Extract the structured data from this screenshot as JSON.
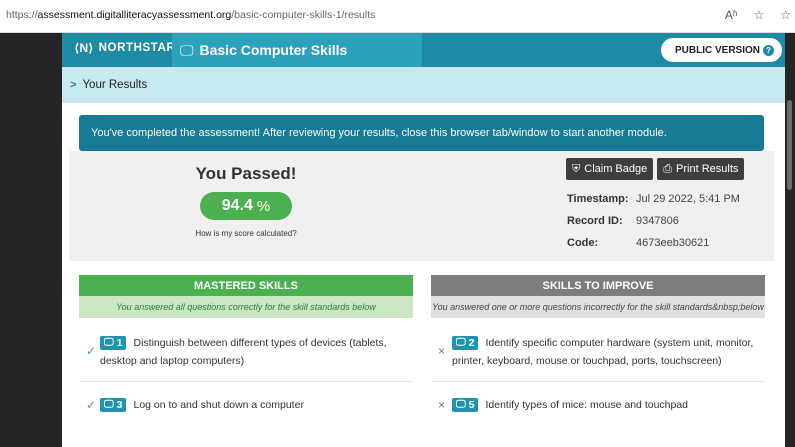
{
  "browser": {
    "url_prefix": "https://",
    "url_host": "assessment.digitalliteracyassessment.org",
    "url_path": "/basic-computer-skills-1/results",
    "icons": [
      "read-aloud-icon",
      "favorite-star-icon",
      "favorites-icon"
    ],
    "icon_glyphs": {
      "read": "Aʱ",
      "star": "☆",
      "fav": "☆"
    }
  },
  "header": {
    "logo_text": "NORTHSTAR",
    "module_title": "Basic Computer Skills",
    "public_version_label": "PUBLIC VERSION"
  },
  "breadcrumb": {
    "label": "Your Results"
  },
  "banner": {
    "text": "You've completed the assessment! After reviewing your results, close this browser tab/window to start another module."
  },
  "result": {
    "heading": "You Passed!",
    "score": "94.4",
    "score_unit": "%",
    "how_link": "How is my score calculated?",
    "claim_badge_label": "Claim Badge",
    "print_results_label": "Print Results",
    "meta": [
      {
        "key": "Timestamp:",
        "value": "Jul 29 2022, 5:41 PM"
      },
      {
        "key": "Record ID:",
        "value": "9347806"
      },
      {
        "key": "Code:",
        "value": "4673eeb30621"
      }
    ]
  },
  "mastered": {
    "title": "MASTERED SKILLS",
    "subtitle": "You answered all questions correctly for the skill standards below",
    "items": [
      {
        "num": "1",
        "text": "Distinguish between different types of devices (tablets, desktop and laptop computers)"
      },
      {
        "num": "3",
        "text": "Log on to and shut down a computer"
      }
    ]
  },
  "improve": {
    "title": "SKILLS TO IMPROVE",
    "subtitle": "You answered one or more questions incorrectly for the skill standards&nbsp;below",
    "items": [
      {
        "num": "2",
        "text": "Identify specific computer hardware (system unit, monitor, printer, keyboard, mouse or touchpad, ports, touchscreen)"
      },
      {
        "num": "5",
        "text": "Identify types of mice: mouse and touchpad"
      }
    ]
  },
  "colors": {
    "brand_teal": "#1e8aa3",
    "success_green": "#4caf50",
    "improve_gray": "#7d7d7d"
  }
}
